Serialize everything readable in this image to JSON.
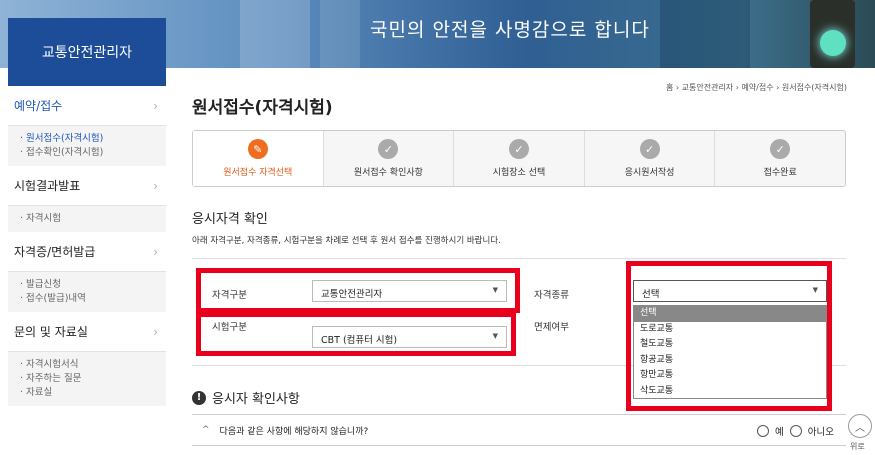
{
  "banner": {
    "slogan": "국민의 안전을 사명감으로 합니다"
  },
  "logo": {
    "text": "교통안전관리자"
  },
  "sidebar": {
    "menus": [
      {
        "label": "예약/접수",
        "sub": [
          "· 원서접수(자격시험)",
          "· 접수확인(자격시험)"
        ]
      },
      {
        "label": "시험결과발표",
        "sub": [
          "· 자격시험"
        ]
      },
      {
        "label": "자격증/면허발급",
        "sub": [
          "· 발급신청",
          "· 접수(발급)내역"
        ]
      },
      {
        "label": "문의 및 자료실",
        "sub": [
          "· 자격시험서식",
          "· 자주하는 질문",
          "· 자료실"
        ]
      }
    ],
    "chevron": "›"
  },
  "breadcrumb": "홈 › 교통안전관리자 › 예약/접수 › 원서접수(자격시험)",
  "page_title": "원서접수(자격시험)",
  "steps": [
    {
      "label": "원서접수 자격선택",
      "icon": "pencil-icon",
      "glyph": "✎"
    },
    {
      "label": "원서접수 확인사항",
      "icon": "check-icon",
      "glyph": "✓"
    },
    {
      "label": "시험장소 선택",
      "icon": "check-icon",
      "glyph": "✓"
    },
    {
      "label": "응시원서작성",
      "icon": "check-icon",
      "glyph": "✓"
    },
    {
      "label": "접수완료",
      "icon": "check-icon",
      "glyph": "✓"
    }
  ],
  "section": {
    "title": "응시자격 확인",
    "description": "아래 자격구분, 자격종류, 시험구분을 차례로 선택 후 원서 접수를 진행하시기 바랍니다."
  },
  "form": {
    "qual_category": {
      "label": "자격구분",
      "value": "교통안전관리자"
    },
    "qual_type": {
      "label": "자격종류",
      "value": "선택"
    },
    "exam_type": {
      "label": "시험구분",
      "value": "CBT (컴퓨터 시험)"
    },
    "exemption": {
      "label": "면제여부"
    },
    "dropdown_options": [
      "선택",
      "도로교통",
      "철도교통",
      "항공교통",
      "항만교통",
      "삭도교통"
    ],
    "dropdown_selected": "선택",
    "arrow": "▼"
  },
  "confirm": {
    "title": "응시자 확인사항",
    "question": "다음과 같은 사항에 해당하지 않습니까?",
    "caret": "^",
    "yes": "예",
    "no": "아니오"
  },
  "top_button": {
    "label": "위로",
    "glyph": "︿"
  },
  "colors": {
    "accent": "#1f56b8",
    "step_active": "#f06d1f",
    "highlight_box": "#e8001c"
  }
}
